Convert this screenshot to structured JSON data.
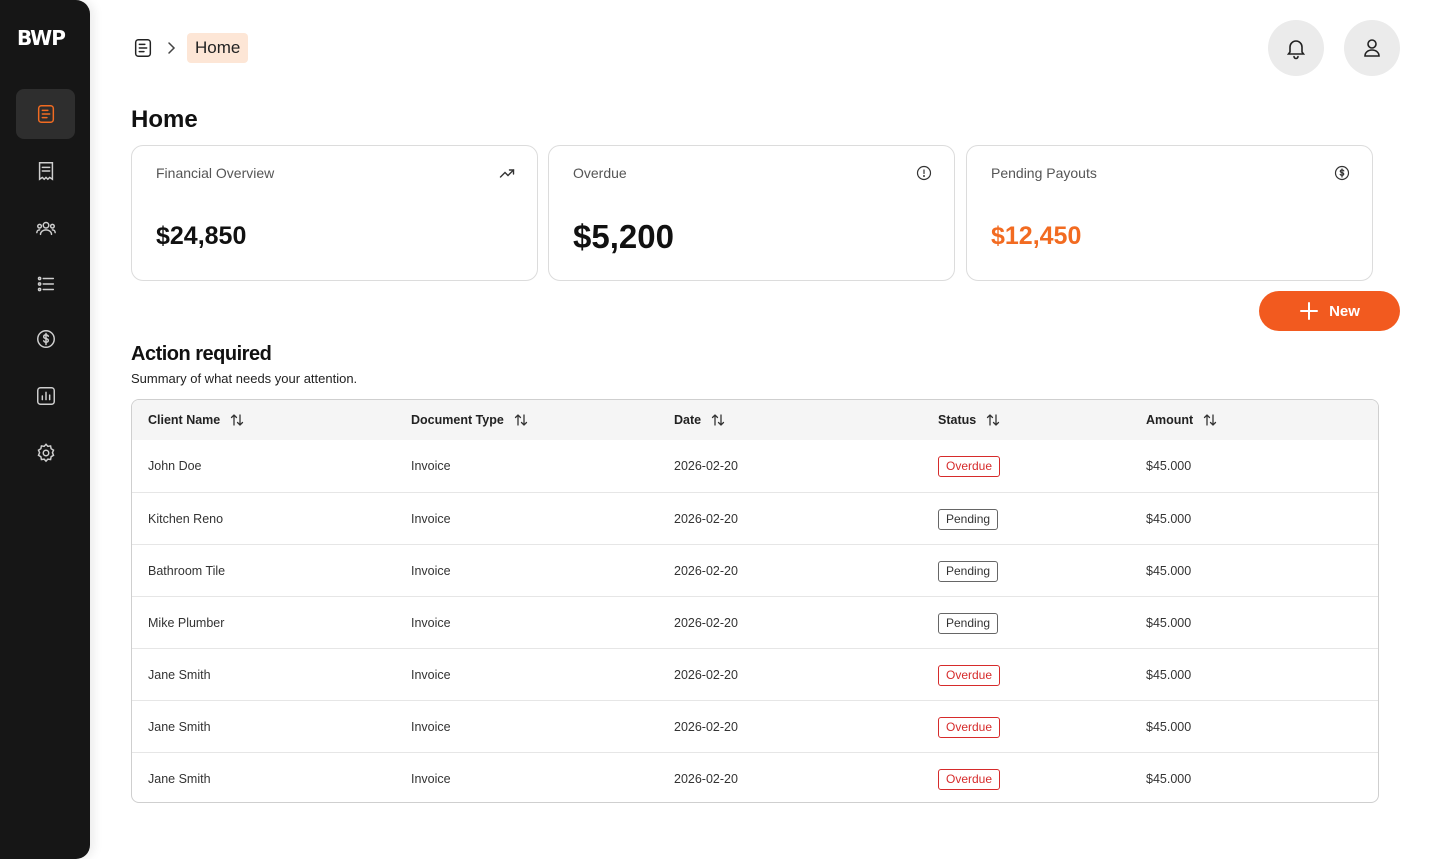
{
  "app": {
    "logo": "BWP"
  },
  "sidebar": {
    "items": [
      {
        "name": "home",
        "icon": "document-list-icon",
        "active": true
      },
      {
        "name": "documents",
        "icon": "receipt-icon",
        "active": false
      },
      {
        "name": "clients",
        "icon": "users-icon",
        "active": false
      },
      {
        "name": "tasks",
        "icon": "list-icon",
        "active": false
      },
      {
        "name": "payments",
        "icon": "dollar-circle-icon",
        "active": false
      },
      {
        "name": "reports",
        "icon": "bar-chart-icon",
        "active": false
      },
      {
        "name": "settings",
        "icon": "gear-icon",
        "active": false
      }
    ]
  },
  "breadcrumb": {
    "current": "Home"
  },
  "header": {
    "notifications_icon": "bell-icon",
    "profile_icon": "user-icon"
  },
  "page": {
    "title": "Home"
  },
  "cards": [
    {
      "label": "Financial Overview",
      "value": "$24,850",
      "icon": "trending-up-icon"
    },
    {
      "label": "Overdue",
      "value": "$5,200",
      "icon": "info-circle-icon"
    },
    {
      "label": "Pending Payouts",
      "value": "$12,450",
      "icon": "dollar-circle-icon",
      "accent": "#f26b21"
    }
  ],
  "new_button": {
    "label": "New"
  },
  "section": {
    "title": "Action required",
    "subtitle": "Summary of what needs your attention."
  },
  "table": {
    "columns": [
      "Client Name",
      "Document Type",
      "Date",
      "Status",
      "Amount"
    ],
    "rows": [
      {
        "client": "John Doe",
        "type": "Invoice",
        "date": "2026-02-20",
        "status": "Overdue",
        "amount": "$45.000"
      },
      {
        "client": "Kitchen Reno",
        "type": "Invoice",
        "date": "2026-02-20",
        "status": "Pending",
        "amount": "$45.000"
      },
      {
        "client": "Bathroom Tile",
        "type": "Invoice",
        "date": "2026-02-20",
        "status": "Pending",
        "amount": "$45.000"
      },
      {
        "client": "Mike Plumber",
        "type": "Invoice",
        "date": "2026-02-20",
        "status": "Pending",
        "amount": "$45.000"
      },
      {
        "client": "Jane Smith",
        "type": "Invoice",
        "date": "2026-02-20",
        "status": "Overdue",
        "amount": "$45.000"
      },
      {
        "client": "Jane Smith",
        "type": "Invoice",
        "date": "2026-02-20",
        "status": "Overdue",
        "amount": "$45.000"
      },
      {
        "client": "Jane Smith",
        "type": "Invoice",
        "date": "2026-02-20",
        "status": "Overdue",
        "amount": "$45.000"
      }
    ]
  },
  "colors": {
    "accent": "#f25a1f",
    "overdue": "#d62b2b",
    "sidebar": "#161616"
  }
}
